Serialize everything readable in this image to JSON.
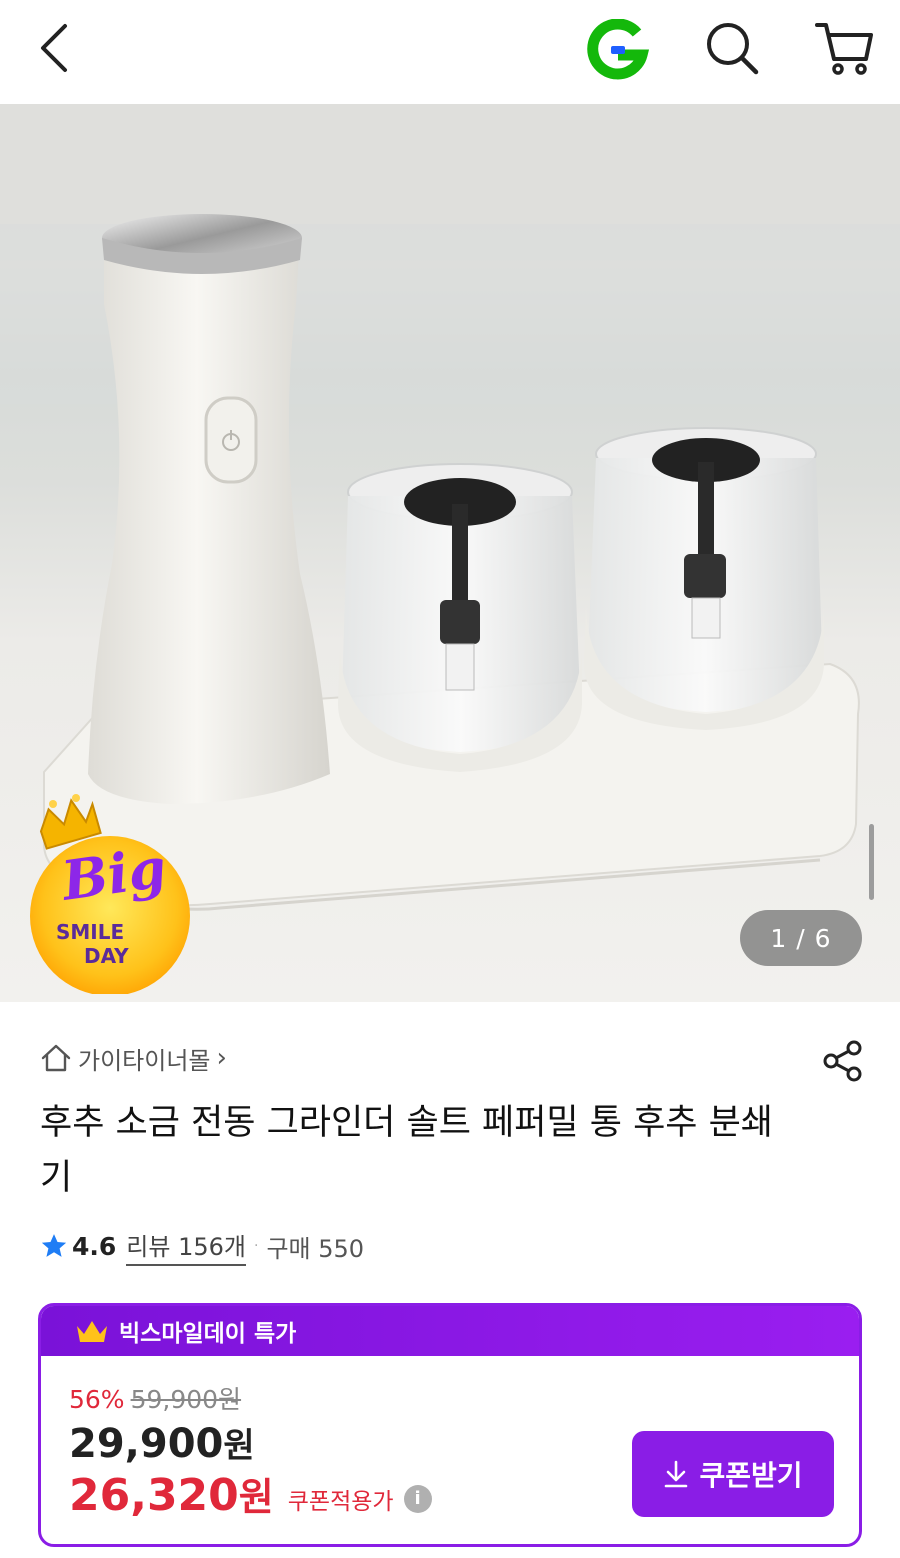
{
  "header": {
    "back_icon": "chevron-left-icon",
    "logo_letter": "G",
    "brand_colors": {
      "green": "#14b80b",
      "blue": "#1f5fff"
    },
    "search_icon": "search-icon",
    "cart_icon": "cart-icon"
  },
  "gallery": {
    "pager_text": "1 / 6",
    "badge": {
      "line1": "Big",
      "line2": "SMILE",
      "line3": "DAY"
    }
  },
  "product": {
    "store_name": "가이타이너몰",
    "store_chevron": "›",
    "title": "후추 소금 전동 그라인더 솔트 페퍼밀 통 후추 분쇄기",
    "rating_score": "4.6",
    "reviews_label": "리뷰 156개",
    "purchases_label": "구매 550",
    "dot": "·"
  },
  "promo": {
    "header_label": "빅스마일데이 특가",
    "discount_rate": "56%",
    "original_price": "59,900원",
    "price_number": "29,900",
    "price_unit": "원",
    "coupon_price_number": "26,320",
    "coupon_price_unit": "원",
    "coupon_price_label": "쿠폰적용가",
    "info_symbol": "i",
    "coupon_button_label": "쿠폰받기",
    "accent_color": "#8a1de6",
    "red_color": "#e0283a"
  }
}
